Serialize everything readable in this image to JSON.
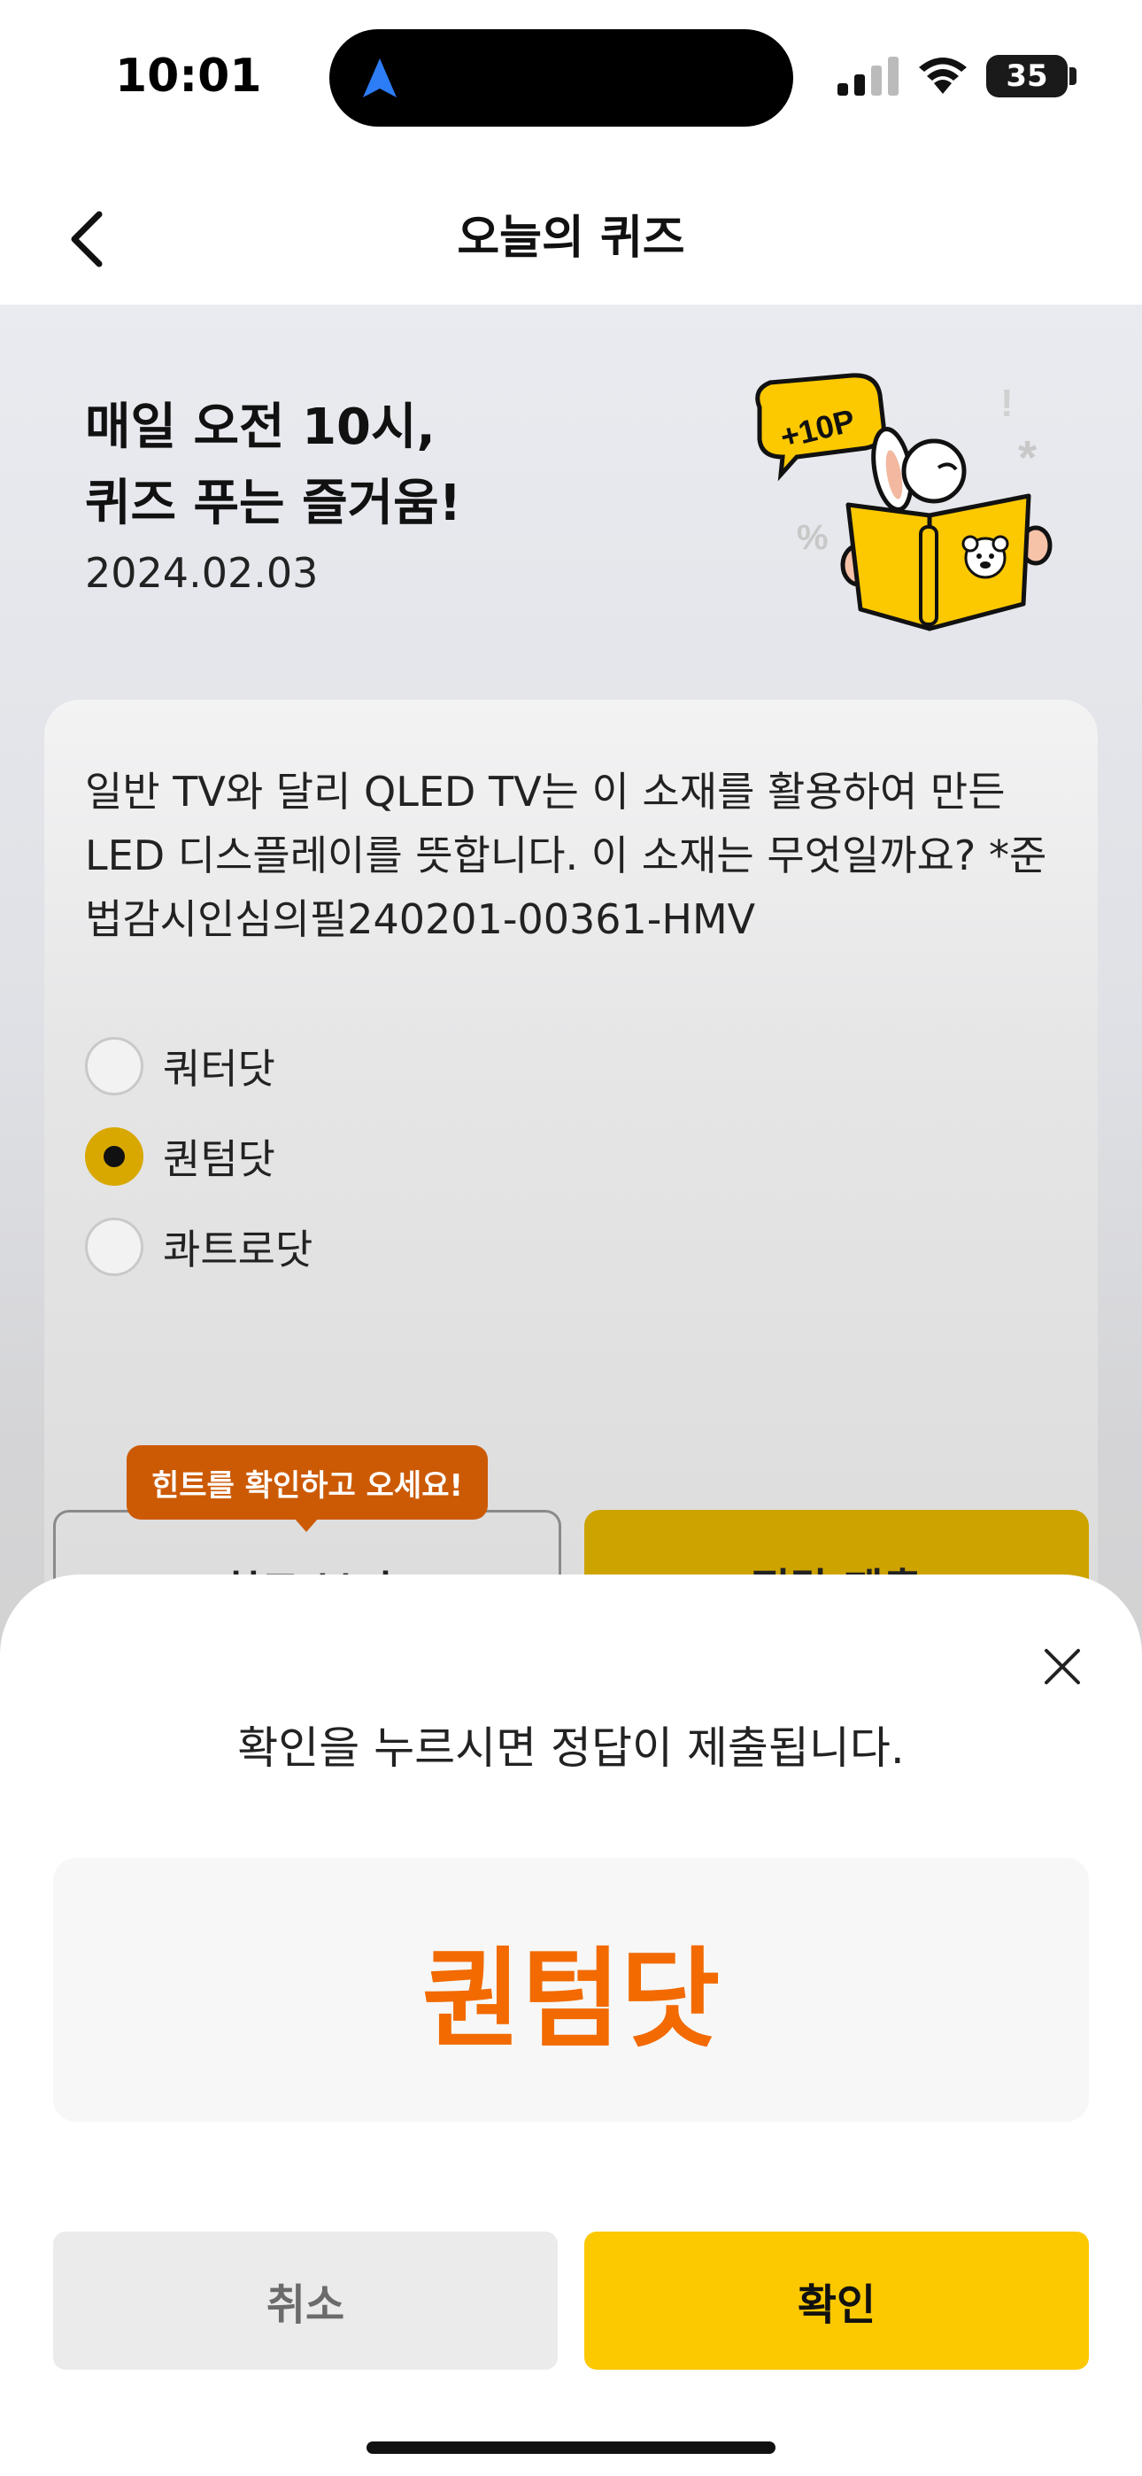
{
  "status_bar": {
    "time": "10:01",
    "battery_level": "35",
    "icons": [
      "location-arrow-icon",
      "signal-icon",
      "wifi-icon",
      "battery-icon"
    ]
  },
  "header": {
    "title": "오늘의 퀴즈",
    "back_icon": "chevron-left-icon"
  },
  "hero": {
    "headline_line1": "매일 오전 10시,",
    "headline_line2": "퀴즈 푸는 즐거움!",
    "date": "2024.02.03",
    "badge_text": "+10P"
  },
  "quiz": {
    "question": "일반 TV와 달리 QLED TV는 이 소재를 활용하여 만든 LED 디스플레이를 뜻합니다. 이 소재는 무엇일까요? *준법감시인심의필240201-00361-HMV",
    "options": [
      {
        "label": "쿼터닷",
        "selected": false
      },
      {
        "label": "퀀텀닷",
        "selected": true
      },
      {
        "label": "콰트로닷",
        "selected": false
      }
    ],
    "hint_tooltip": "힌트를 확인하고 오세요!",
    "hint_button": "힌트 보기",
    "submit_button": "정답 제출"
  },
  "sheet": {
    "message": "확인을 누르시면 정답이 제출됩니다.",
    "selected_answer": "퀀텀닷",
    "cancel_label": "취소",
    "confirm_label": "확인",
    "close_icon": "close-icon"
  },
  "colors": {
    "accent_yellow": "#fcc800",
    "answer_orange": "#f26a00",
    "tooltip_orange": "#cc5a05",
    "radio_selected": "#d8a800"
  }
}
